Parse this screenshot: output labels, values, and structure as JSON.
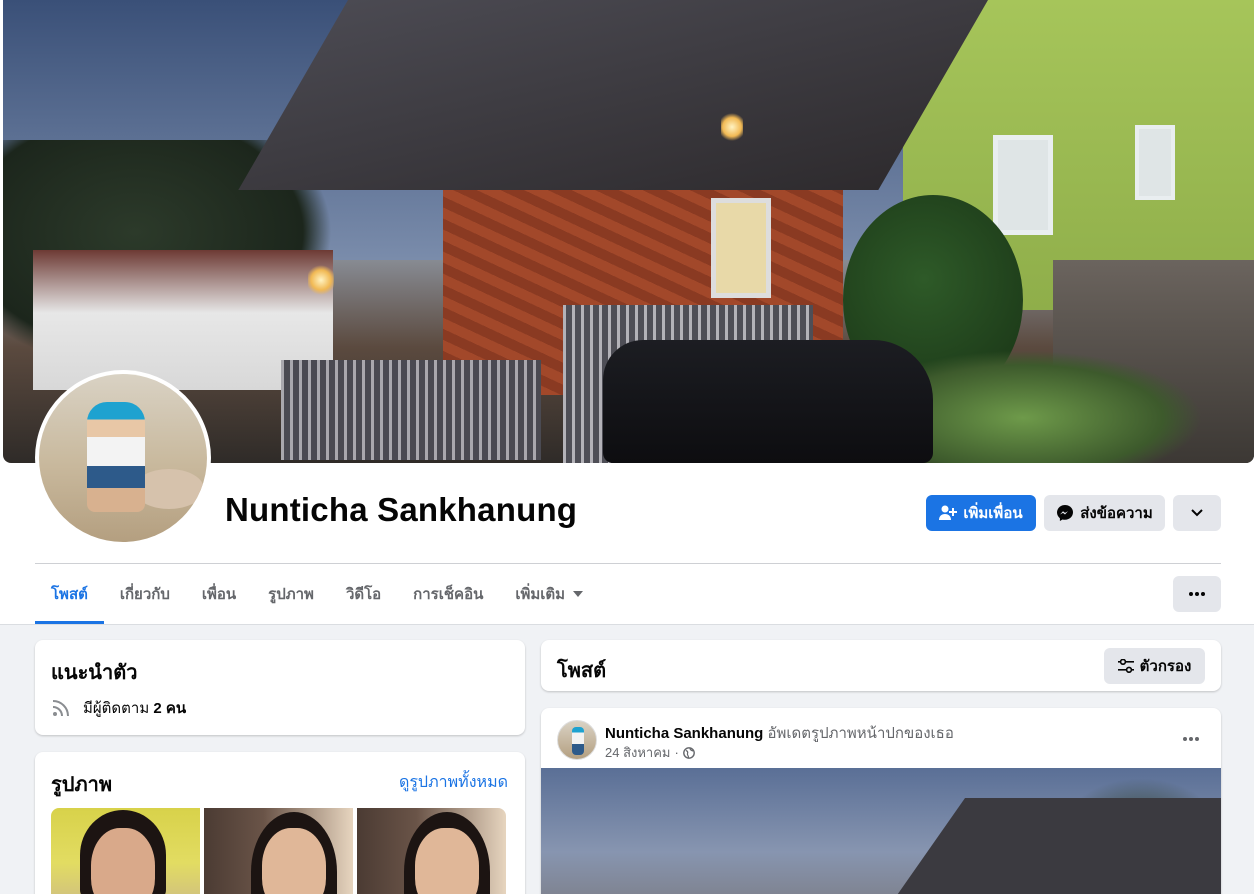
{
  "profile": {
    "name": "Nunticha Sankhanung",
    "add_friend_label": "เพิ่มเพื่อน",
    "message_label": "ส่งข้อความ"
  },
  "tabs": [
    {
      "label": "โพสต์",
      "active": true
    },
    {
      "label": "เกี่ยวกับ"
    },
    {
      "label": "เพื่อน"
    },
    {
      "label": "รูปภาพ"
    },
    {
      "label": "วิดีโอ"
    },
    {
      "label": "การเช็คอิน"
    },
    {
      "label": "เพิ่มเติม"
    }
  ],
  "intro": {
    "title": "แนะนำตัว",
    "followers_prefix": "มีผู้ติดตาม",
    "followers_count": "2 คน"
  },
  "photos": {
    "title": "รูปภาพ",
    "see_all": "ดูรูปภาพทั้งหมด"
  },
  "posts": {
    "title": "โพสต์",
    "filter_label": "ตัวกรอง"
  },
  "post": {
    "author": "Nunticha Sankhanung",
    "action": "อัพเดตรูปภาพหน้าปกของเธอ",
    "date": "24 สิงหาคม",
    "separator": "·"
  },
  "colors": {
    "accent": "#1b74e4",
    "background": "#f0f2f5",
    "button_gray": "#e4e6eb",
    "secondary_text": "#65676b"
  }
}
